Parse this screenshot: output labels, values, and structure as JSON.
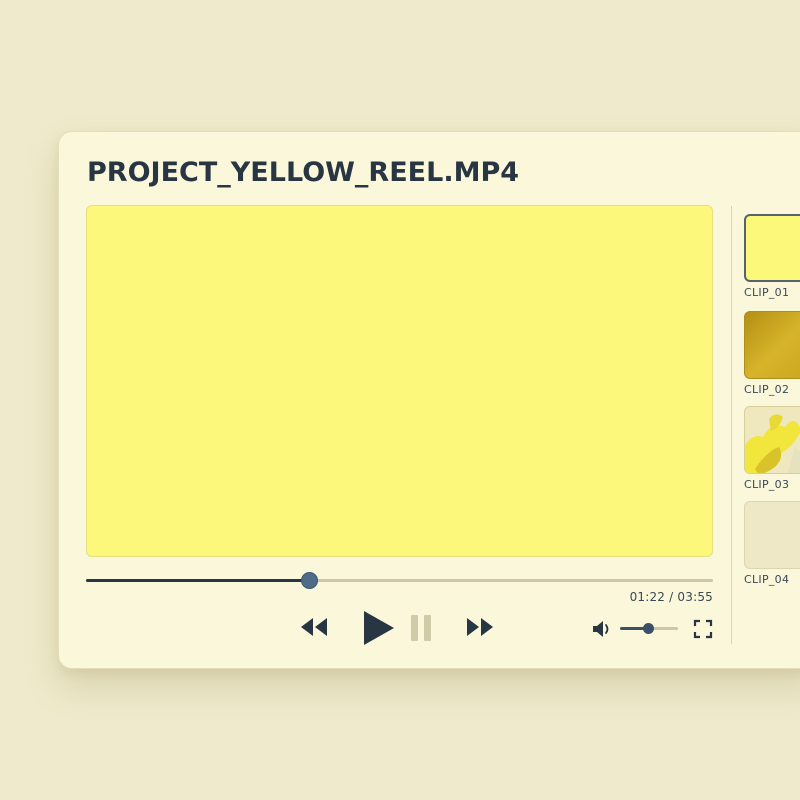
{
  "title": "PROJECT_YELLOW_REEL.MP4",
  "player": {
    "current_time": "01:22",
    "duration": "03:55",
    "time_display": "01:22 / 03:55",
    "progress_fraction": 0.355,
    "volume_fraction": 0.48
  },
  "controls": {
    "rewind_icon": "rewind-icon",
    "play_icon": "play-icon",
    "pause_icon": "pause-icon",
    "fast_forward_icon": "fast-forward-icon",
    "volume_icon": "volume-icon",
    "fullscreen_icon": "fullscreen-icon"
  },
  "clips": [
    {
      "label": "CLIP_01",
      "selected": true
    },
    {
      "label": "CLIP_02",
      "selected": false
    },
    {
      "label": "CLIP_03",
      "selected": false
    },
    {
      "label": "CLIP_04",
      "selected": false
    }
  ],
  "colors": {
    "background": "#efeacb",
    "panel": "#faf7da",
    "video": "#fbf87c",
    "text_dark": "#283542",
    "accent": "#4f6b88"
  }
}
